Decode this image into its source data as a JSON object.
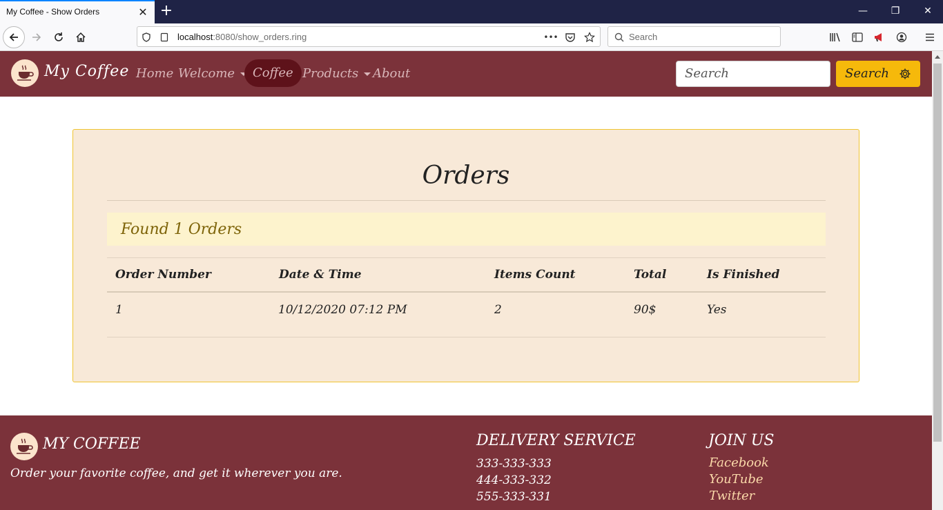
{
  "browser": {
    "tab_title": "My Coffee - Show Orders",
    "tab_close": "✕",
    "new_tab": "+",
    "url_host": "localhost",
    "url_rest": ":8080/show_orders.ring",
    "url_more": "•••",
    "search_placeholder": "Search",
    "window_controls": {
      "minimize": "—",
      "restore": "❐",
      "close": "✕"
    }
  },
  "site": {
    "brand": "My Coffee",
    "nav": {
      "home": "Home",
      "welcome": "Welcome",
      "coffee": "Coffee",
      "products": "Products",
      "about": "About"
    },
    "search_placeholder": "Search",
    "search_button": "Search"
  },
  "orders": {
    "title": "Orders",
    "found_text": "Found 1 Orders",
    "columns": [
      "Order Number",
      "Date & Time",
      "Items Count",
      "Total",
      "Is Finished"
    ],
    "rows": [
      [
        "1",
        "10/12/2020 07:12 PM",
        "2",
        "90$",
        "Yes"
      ]
    ]
  },
  "footer": {
    "brand": "MY COFFEE",
    "tagline": "Order your favorite coffee, and get it wherever you are.",
    "delivery_heading": "DELIVERY SERVICE",
    "phones": [
      "333-333-333",
      "444-333-332",
      "555-333-331"
    ],
    "join_heading": "JOIN US",
    "social": [
      "Facebook",
      "YouTube",
      "Twitter"
    ]
  },
  "colors": {
    "brand_maroon": "#7b323a",
    "active_pill": "#5e121a",
    "search_yellow": "#f6b90b",
    "panel_bg": "#f8e9d8",
    "alert_bg": "#fdf3cd"
  }
}
